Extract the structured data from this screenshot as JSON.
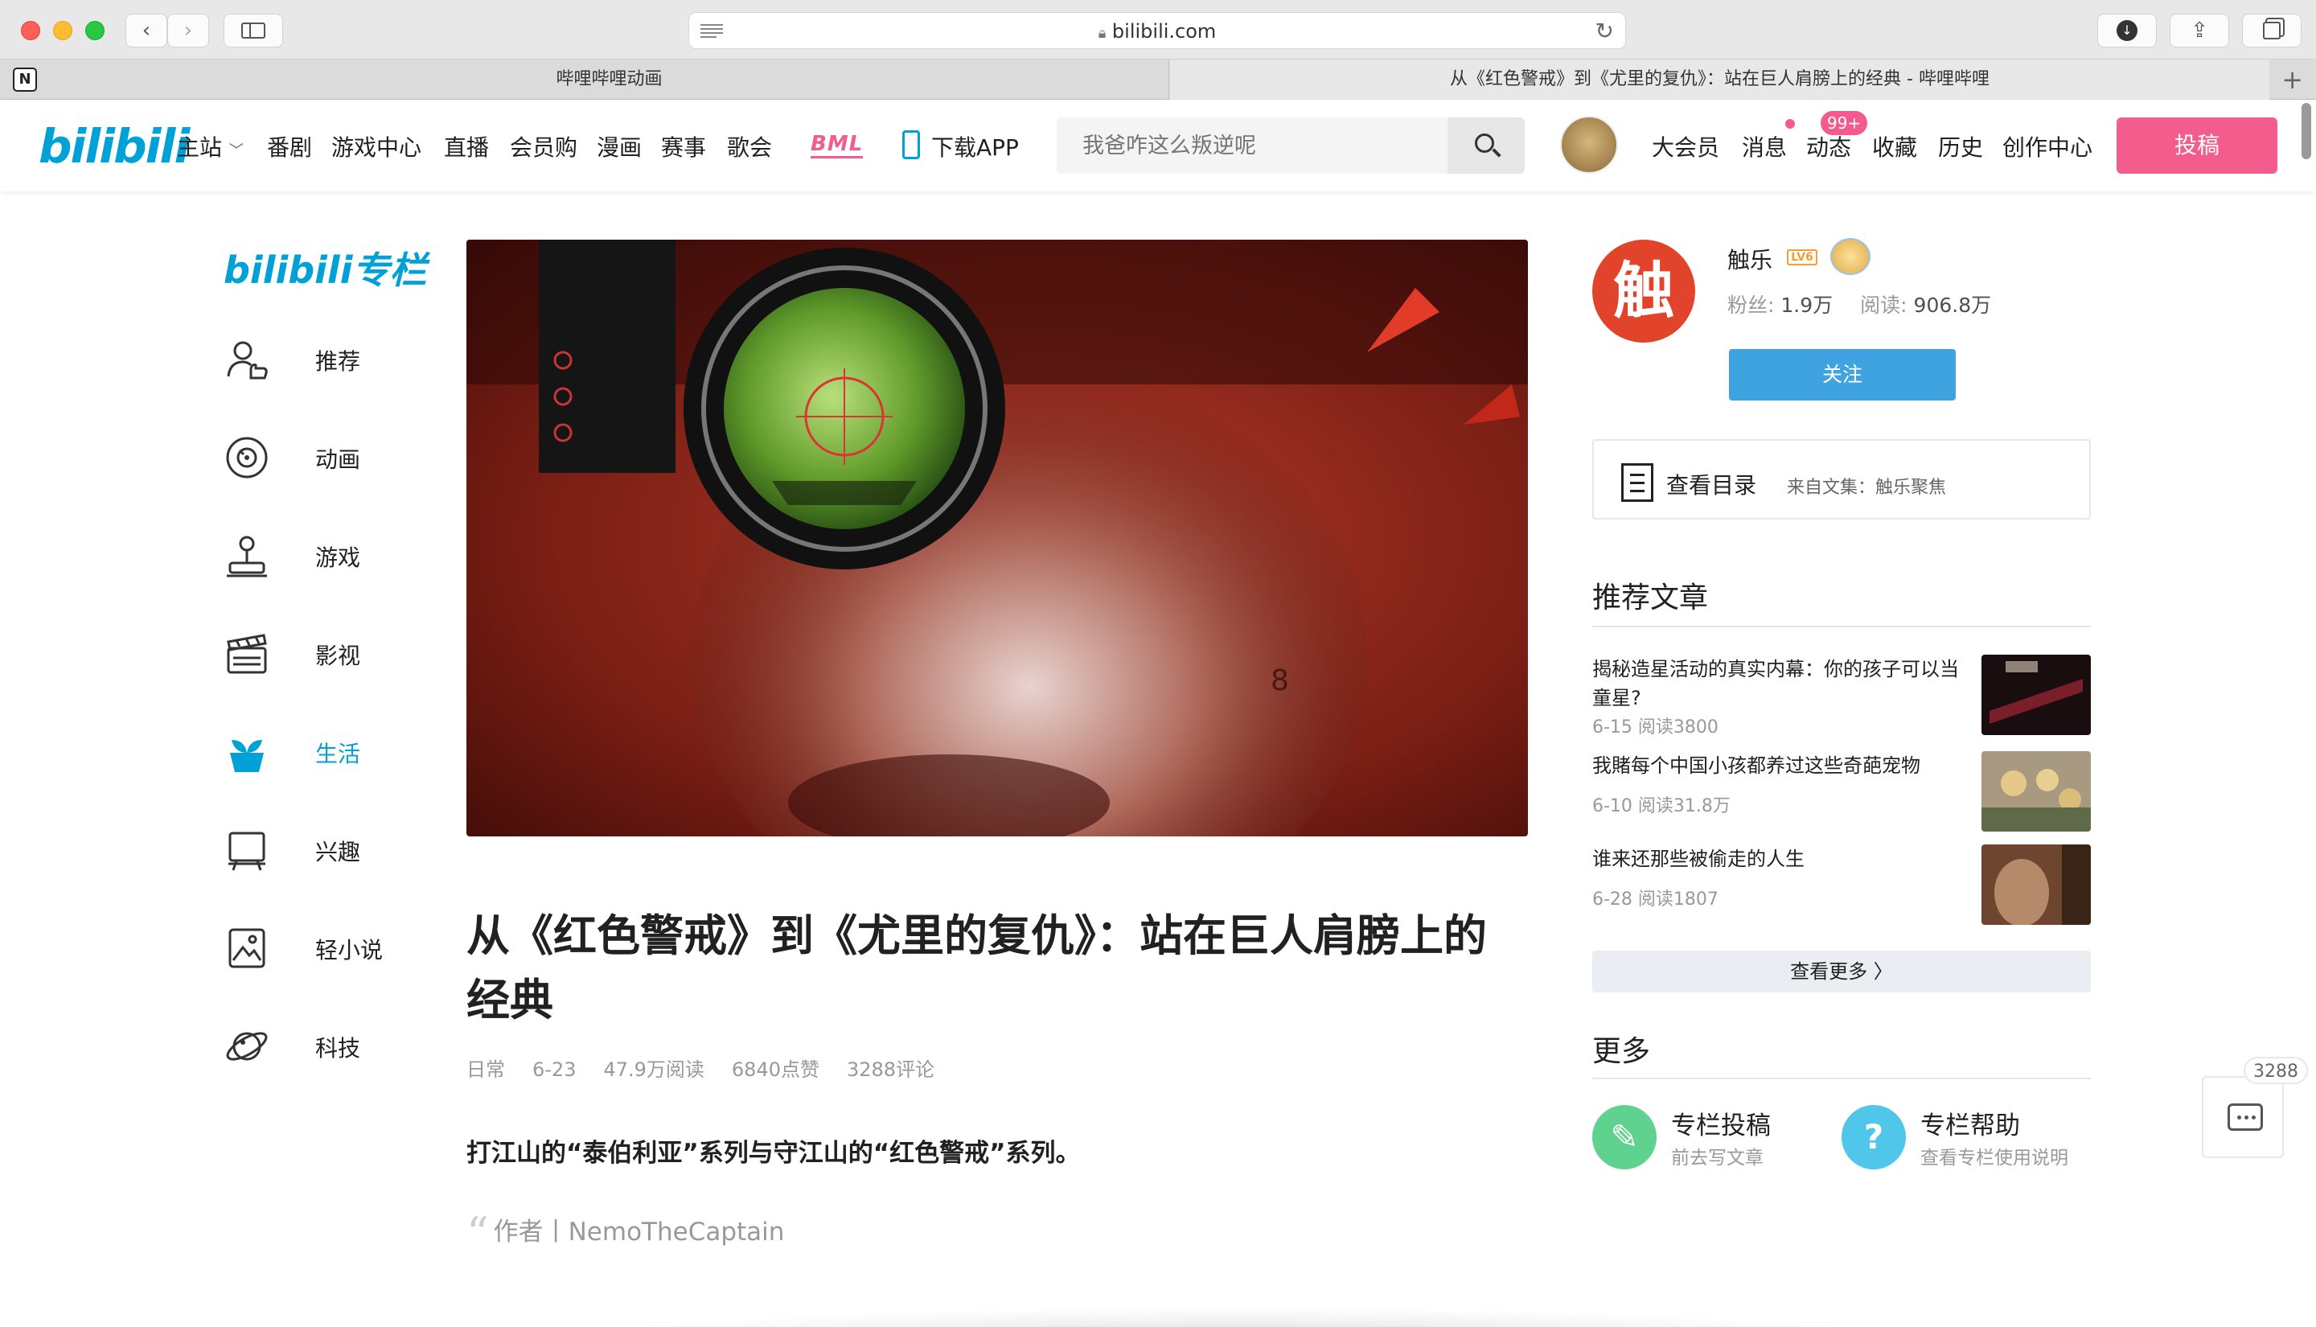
{
  "browser": {
    "url": "bilibili.com",
    "tabs": [
      {
        "label": "哔哩哔哩动画"
      },
      {
        "label": "从《红色警戒》到《尤里的复仇》：站在巨人肩膀上的经典 - 哔哩哔哩"
      }
    ]
  },
  "header": {
    "logo": "bilibili",
    "nav": [
      "主站",
      "番剧",
      "游戏中心",
      "直播",
      "会员购",
      "漫画",
      "赛事",
      "歌会"
    ],
    "bml": "BML",
    "download": "下载APP",
    "search_placeholder": "我爸咋这么叛逆呢",
    "right_nav": [
      "大会员",
      "消息",
      "动态",
      "收藏",
      "历史",
      "创作中心"
    ],
    "dynamic_badge": "99+",
    "upload": "投稿"
  },
  "sidebar": {
    "logo": "bilibili专栏",
    "items": [
      {
        "label": "推荐",
        "icon": "recommend-icon"
      },
      {
        "label": "动画",
        "icon": "animation-icon"
      },
      {
        "label": "游戏",
        "icon": "joystick-icon"
      },
      {
        "label": "影视",
        "icon": "clapperboard-icon"
      },
      {
        "label": "生活",
        "icon": "plant-icon",
        "active": true
      },
      {
        "label": "兴趣",
        "icon": "easel-icon"
      },
      {
        "label": "轻小说",
        "icon": "picture-frame-icon"
      },
      {
        "label": "科技",
        "icon": "planet-icon"
      }
    ]
  },
  "article": {
    "title": "从《红色警戒》到《尤里的复仇》：站在巨人肩膀上的经典",
    "category": "日常",
    "date": "6-23",
    "reads": "47.9万阅读",
    "likes": "6840点赞",
    "comments": "3288评论",
    "lead": "打江山的“泰伯利亚”系列与守江山的“红色警戒”系列。",
    "author_label": "作者丨NemoTheCaptain"
  },
  "up": {
    "avatar_char": "触",
    "name": "触乐",
    "level": "LV6",
    "fans_label": "粉丝:",
    "fans": "1.9万",
    "reads_label": "阅读:",
    "reads": "906.8万",
    "follow": "关注"
  },
  "toc": {
    "label": "查看目录",
    "from": "来自文集：触乐聚焦"
  },
  "recommend": {
    "title": "推荐文章",
    "items": [
      {
        "title": "揭秘造星活动的真实内幕：你的孩子可以当童星?",
        "meta": "6-15 阅读3800"
      },
      {
        "title": "我賭每个中国小孩都养过这些奇葩宠物",
        "meta": "6-10 阅读31.8万"
      },
      {
        "title": "谁来还那些被偷走的人生",
        "meta": "6-28 阅读1807"
      }
    ],
    "more": "查看更多 〉"
  },
  "more": {
    "title": "更多",
    "tools": [
      {
        "name": "专栏投稿",
        "desc": "前去写文章",
        "color": "#5fd28f"
      },
      {
        "name": "专栏帮助",
        "desc": "查看专栏使用说明",
        "color": "#4fc6ea"
      }
    ]
  },
  "float": {
    "count": "3288"
  },
  "colors": {
    "brand_blue": "#00a1d6",
    "brand_pink": "#f25d8e",
    "follow_blue": "#3ea3de"
  }
}
